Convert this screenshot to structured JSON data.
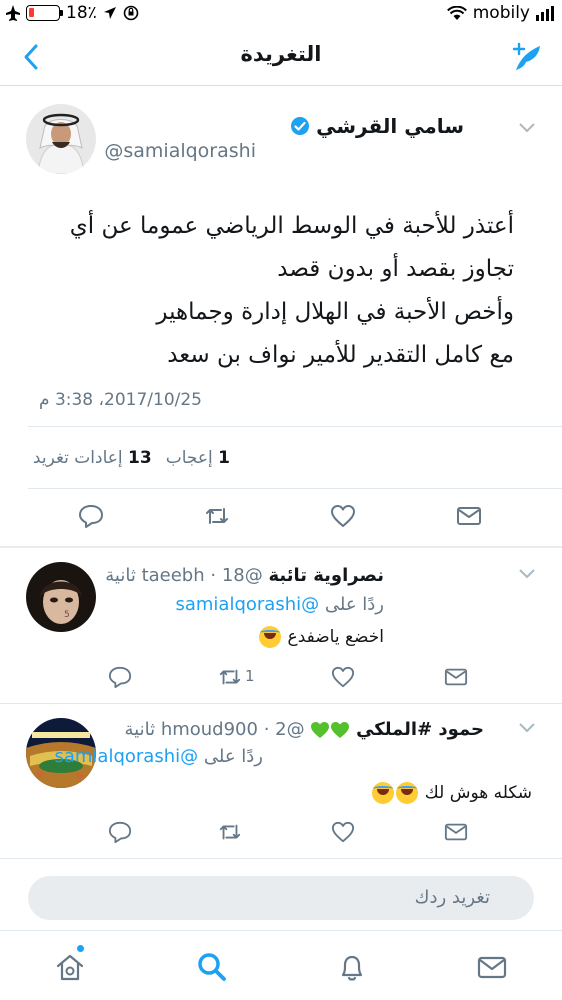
{
  "status_bar": {
    "battery": "18٪",
    "carrier": "mobily"
  },
  "nav": {
    "title": "التغريدة"
  },
  "tweet": {
    "author_name": "سامي القرشي",
    "author_handle": "@samialqorashi",
    "text": "أعتذر للأحبة في الوسط الرياضي عموما عن أي\nتجاوز بقصد أو بدون قصد\nوأخص الأحبة في الهلال إدارة وجماهير\nمع كامل التقدير للأمير نواف بن سعد",
    "timestamp": "2017/10/25، 3:38 م",
    "likes_count": "1",
    "likes_label": "إعجاب",
    "retweets_count": "13",
    "retweets_label": "إعادات تغريد"
  },
  "replies": [
    {
      "name": "نصراوية تائبة",
      "handle": "@taeebh",
      "time": "18 ثانية",
      "replying_to_label": "ردًا على",
      "replying_to": "@samialqorashi",
      "text": "اخضع ياضفدع",
      "retweet_count": "1",
      "avatar_badge": "5"
    },
    {
      "name": "حمود #الملكي",
      "handle": "@hmoud900",
      "time": "2 ثانية",
      "replying_to_label": "ردًا على",
      "replying_to": "@samialqorashi",
      "text": "شكله هوش لك"
    }
  ],
  "compose": {
    "placeholder": "تغريد ردك"
  },
  "colors": {
    "accent": "#1da1f2",
    "secondary_text": "#657786",
    "divider": "#e1e8ed"
  },
  "icons": {
    "back": "chevron-left-icon",
    "compose": "compose-tweet-icon",
    "reply": "reply-icon",
    "retweet": "retweet-icon",
    "like": "heart-icon",
    "dm": "envelope-icon",
    "home": "home-icon",
    "search": "search-icon",
    "notifications": "bell-icon",
    "messages": "envelope-icon"
  }
}
